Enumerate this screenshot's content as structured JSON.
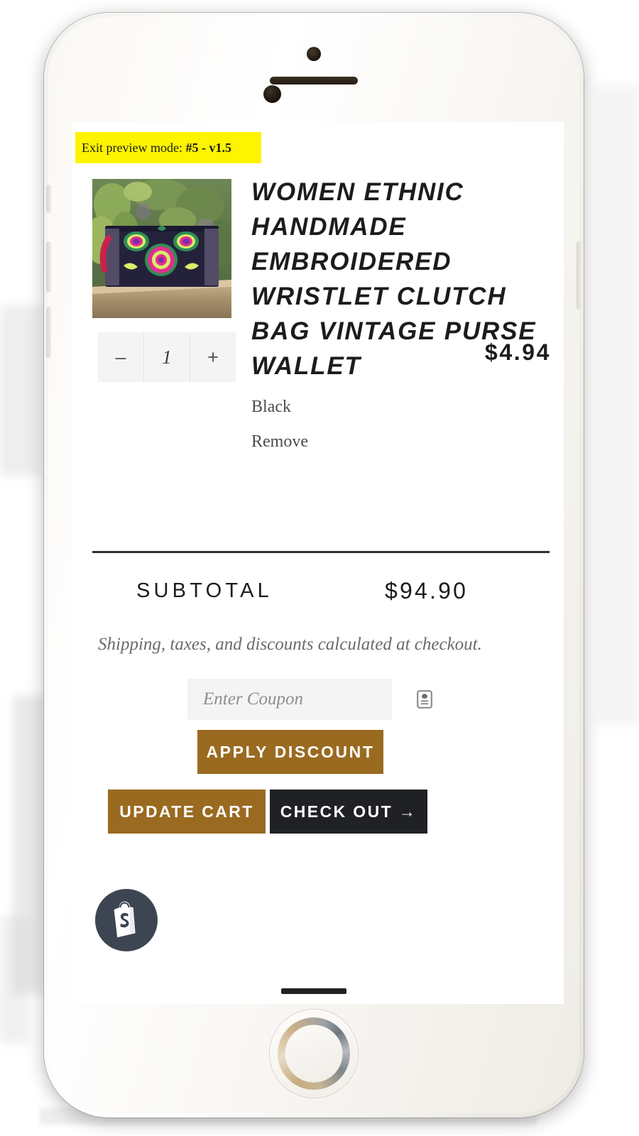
{
  "preview": {
    "label": "Exit preview mode:",
    "version": "#5 - v1.5"
  },
  "cart": {
    "item": {
      "title": "WOMEN ETHNIC HANDMADE EMBROIDERED WRISTLET CLUTCH BAG VINTAGE PURSE WALLET",
      "variant": "Black",
      "remove_label": "Remove",
      "quantity": "1",
      "decrement_label": "–",
      "increment_label": "+",
      "price": "$4.94",
      "image_alt": "embroidered-clutch-bag-photo"
    },
    "subtotal_label": "SUBTOTAL",
    "subtotal_value": "$94.90",
    "notice": "Shipping, taxes, and discounts calculated at checkout.",
    "coupon": {
      "placeholder": "Enter Coupon",
      "value": "",
      "icon": "coupon-tag-icon"
    },
    "buttons": {
      "apply": "APPLY DISCOUNT",
      "update": "UPDATE CART",
      "checkout": "CHECK OUT →"
    }
  },
  "branding": {
    "shopify_logo": "shopify-bag-icon"
  },
  "colors": {
    "preview_bar": "#fcf400",
    "accent_gold": "#9a6a21",
    "checkout_dark": "#1f2124",
    "text_primary": "#1c1c1c",
    "text_muted": "#6a6a6a",
    "field_bg": "#f4f4f4",
    "shopify_navy": "#3c4551"
  }
}
